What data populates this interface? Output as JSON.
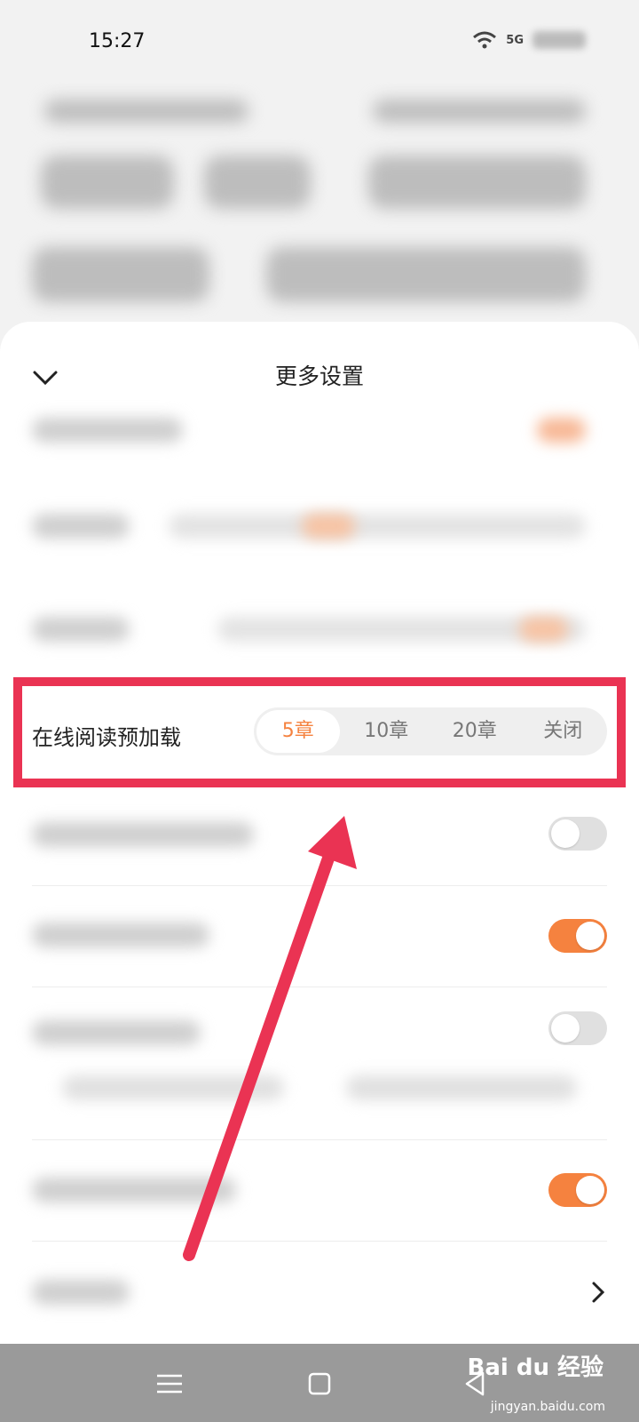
{
  "status_bar": {
    "time": "15:27",
    "network": "5G"
  },
  "sheet": {
    "title": "更多设置"
  },
  "preload": {
    "label": "在线阅读预加载",
    "options": [
      "5章",
      "10章",
      "20章",
      "关闭"
    ],
    "selected": "5章"
  },
  "toggles": [
    {
      "state": "off"
    },
    {
      "state": "on"
    },
    {
      "state": "off"
    },
    {
      "state": "on"
    }
  ],
  "colors": {
    "accent": "#f5823f",
    "highlight": "#ea3353",
    "navbar": "#9a9a9a"
  },
  "watermark": {
    "brand": "Bai du 经验",
    "url": "jingyan.baidu.com"
  }
}
